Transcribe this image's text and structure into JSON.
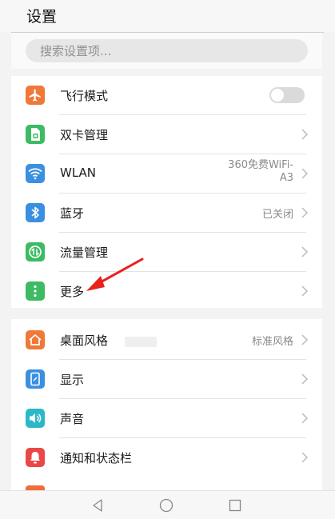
{
  "header": {
    "title": "设置"
  },
  "search": {
    "placeholder": "搜索设置项..."
  },
  "group1": [
    {
      "id": "airplane",
      "label": "飞行模式",
      "icon": "airplane-icon",
      "color": "#f07838",
      "control": "toggle",
      "toggle_on": false
    },
    {
      "id": "dual-sim",
      "label": "双卡管理",
      "icon": "sim-card-icon",
      "color": "#3dbb63",
      "control": "chevron"
    },
    {
      "id": "wlan",
      "label": "WLAN",
      "icon": "wifi-icon",
      "color": "#3b8fe0",
      "value_line1": "360免费WiFi-",
      "value_line2": "A3",
      "control": "chevron"
    },
    {
      "id": "bluetooth",
      "label": "蓝牙",
      "icon": "bluetooth-icon",
      "color": "#3b8fe0",
      "value": "已关闭",
      "control": "chevron"
    },
    {
      "id": "data-usage",
      "label": "流量管理",
      "icon": "data-usage-icon",
      "color": "#3dbb63",
      "control": "chevron"
    },
    {
      "id": "more",
      "label": "更多",
      "icon": "more-dots-icon",
      "color": "#3dbb63",
      "control": "chevron"
    }
  ],
  "group2": [
    {
      "id": "home-style",
      "label": "桌面风格",
      "icon": "home-icon",
      "color": "#f07838",
      "value": "标准风格",
      "control": "chevron"
    },
    {
      "id": "display",
      "label": "显示",
      "icon": "display-icon",
      "color": "#3b8fe0",
      "control": "chevron"
    },
    {
      "id": "sound",
      "label": "声音",
      "icon": "speaker-icon",
      "color": "#2bb8c9",
      "control": "chevron"
    },
    {
      "id": "notifications",
      "label": "通知和状态栏",
      "icon": "bell-icon",
      "color": "#e94848",
      "control": "chevron"
    }
  ],
  "navbar": {
    "back": "back-icon",
    "home": "home-circle-icon",
    "recents": "recents-square-icon"
  },
  "annotation": {
    "color": "#e8211c"
  }
}
